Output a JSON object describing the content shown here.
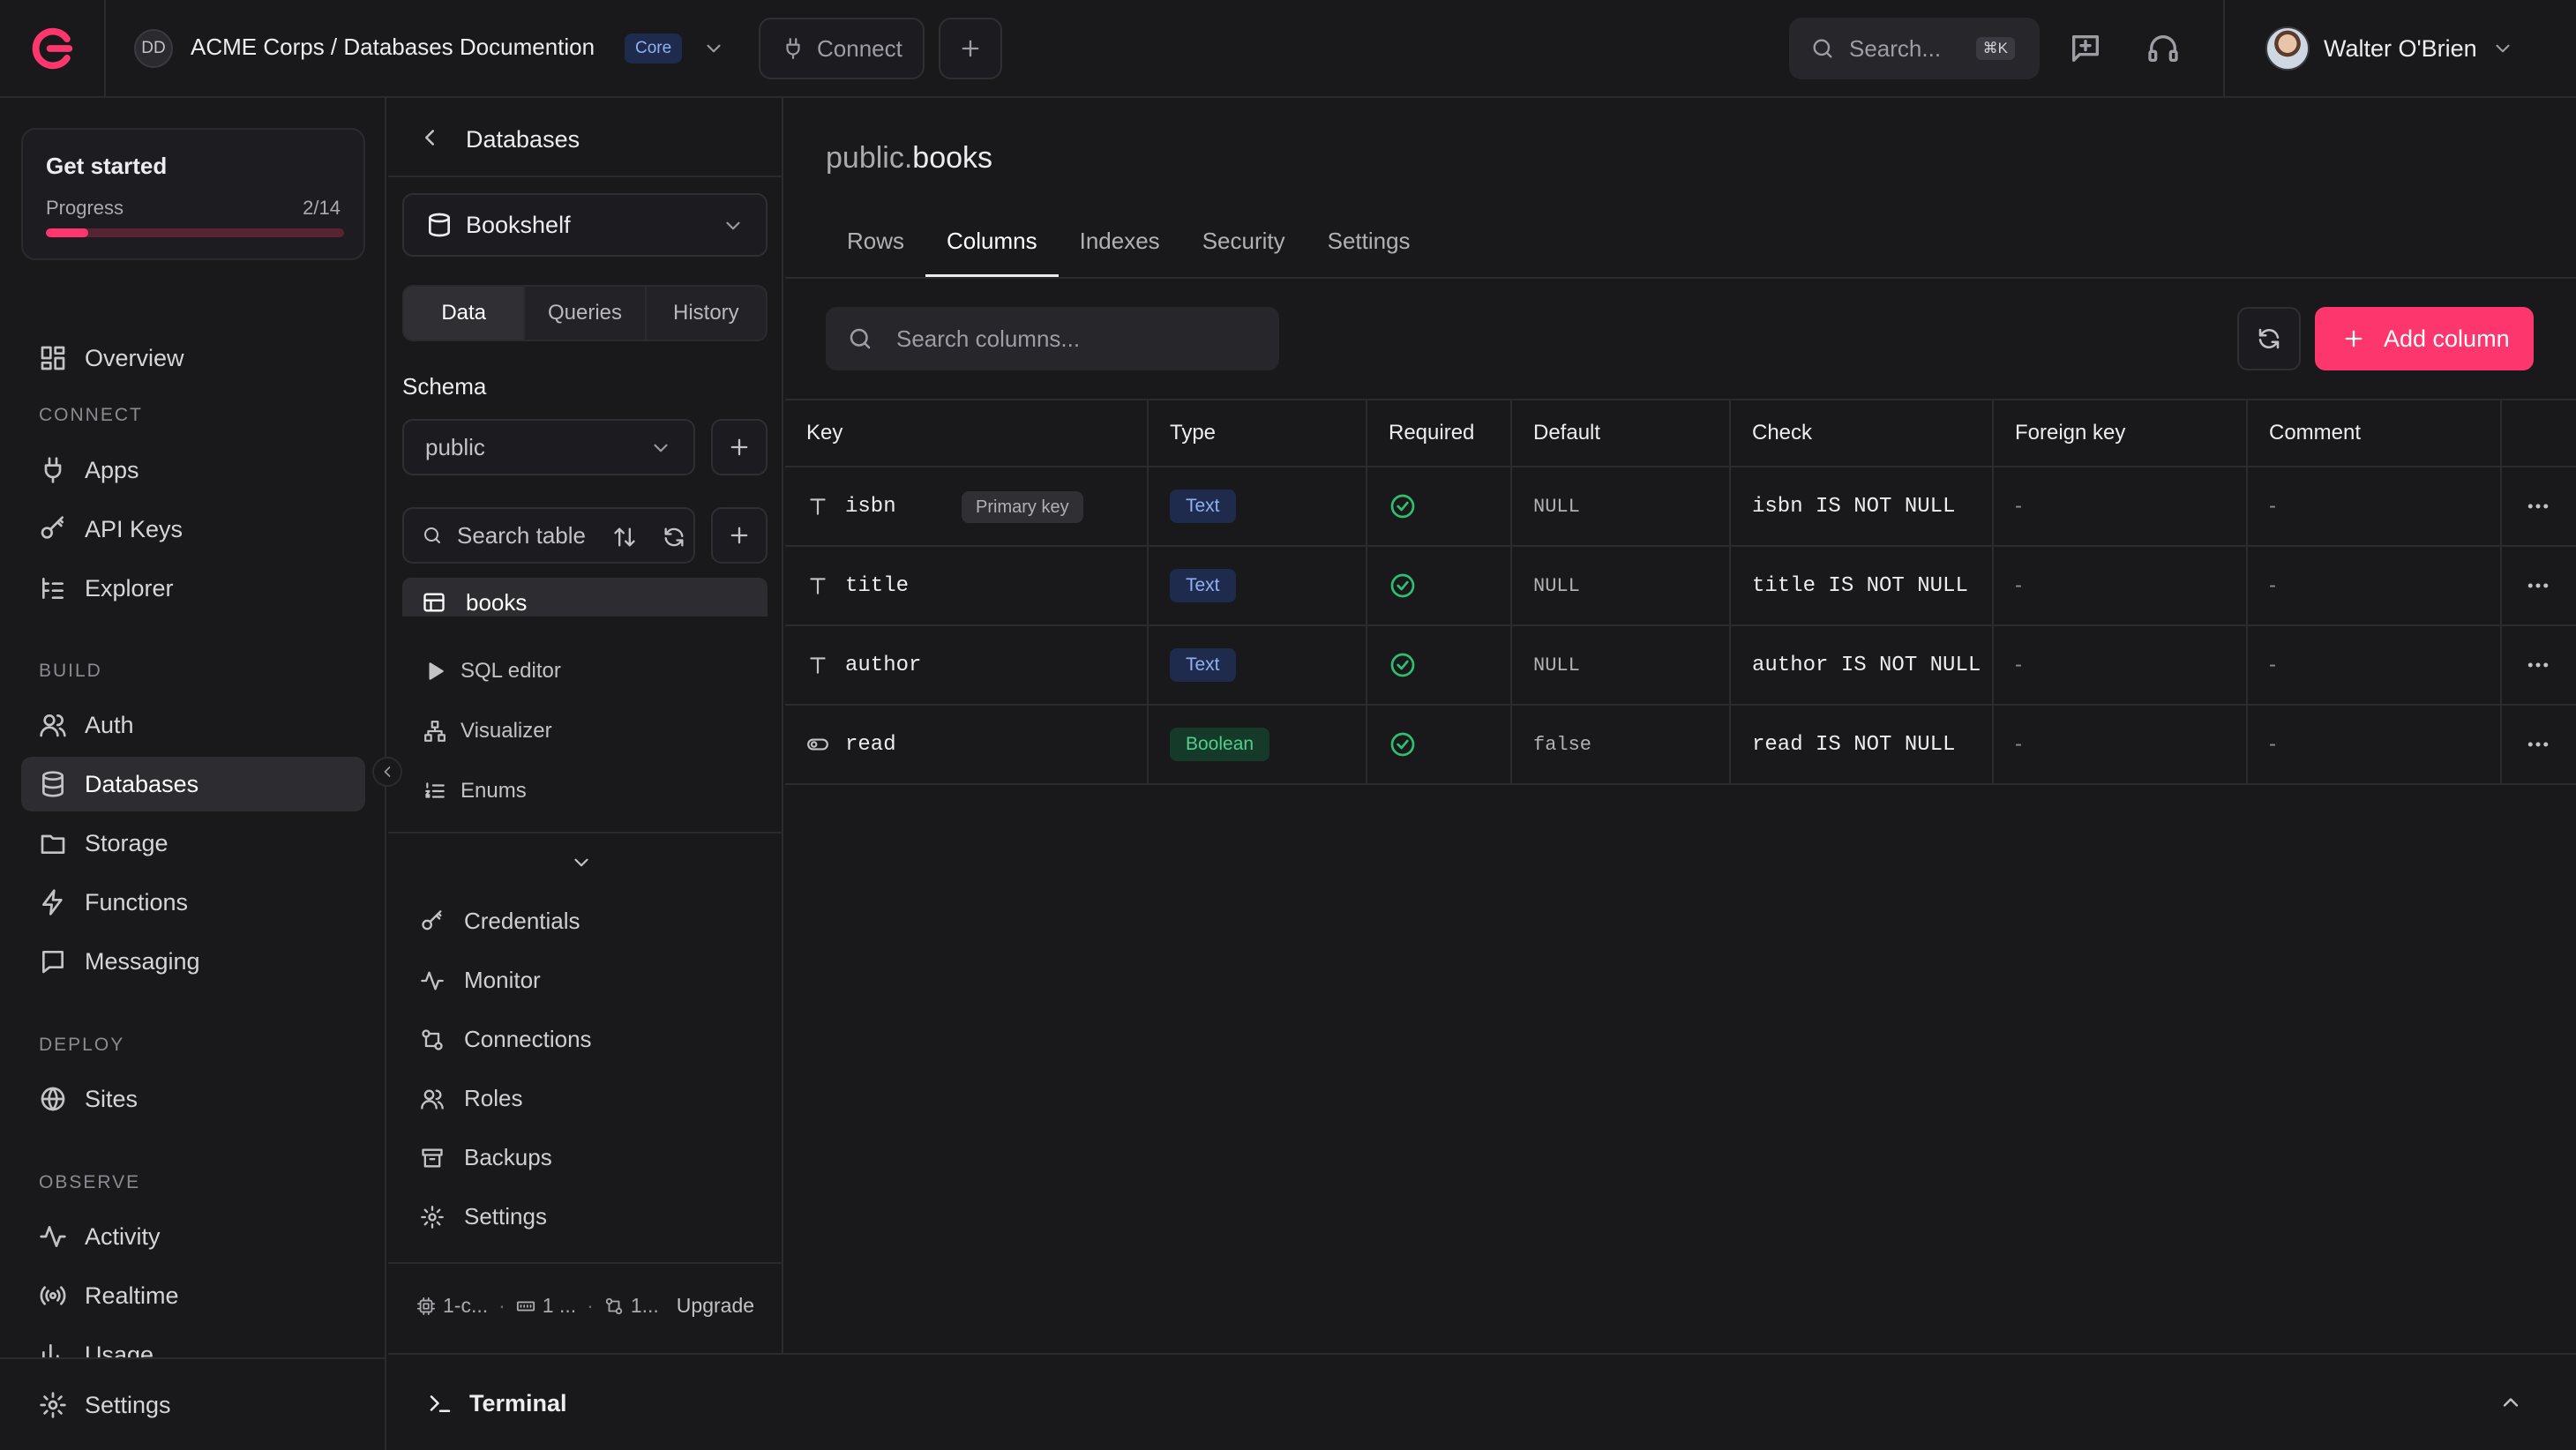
{
  "topbar": {
    "org_initials": "DD",
    "org_title": "ACME Corps / Databases Documention",
    "org_badge": "Core",
    "connect_label": "Connect",
    "search_placeholder": "Search...",
    "search_shortcut": "⌘K",
    "user_name": "Walter O'Brien"
  },
  "sidebar": {
    "get_started": {
      "title": "Get started",
      "progress_label": "Progress",
      "progress_count": "2/14",
      "progress_fraction": 0.143
    },
    "overview": "Overview",
    "sections": {
      "connect": "CONNECT",
      "build": "BUILD",
      "deploy": "DEPLOY",
      "observe": "OBSERVE"
    },
    "connect_items": [
      "Apps",
      "API Keys",
      "Explorer"
    ],
    "build_items": [
      "Auth",
      "Databases",
      "Storage",
      "Functions",
      "Messaging"
    ],
    "deploy_items": [
      "Sites"
    ],
    "observe_items": [
      "Activity",
      "Realtime",
      "Usage"
    ],
    "settings": "Settings",
    "active_item": "Databases"
  },
  "panel": {
    "title": "Databases",
    "database": "Bookshelf",
    "seg_tabs": [
      "Data",
      "Queries",
      "History"
    ],
    "active_seg": "Data",
    "schema_label": "Schema",
    "schema_value": "public",
    "table_search_placeholder": "Search table",
    "tables": [
      "books"
    ],
    "tools": [
      "SQL editor",
      "Visualizer",
      "Enums"
    ],
    "items": [
      "Credentials",
      "Monitor",
      "Connections",
      "Roles",
      "Backups",
      "Settings"
    ],
    "footer": {
      "cpu": "1-c...",
      "memory": "1 ...",
      "connections": "1...",
      "upgrade": "Upgrade"
    }
  },
  "main": {
    "title_schema": "public.",
    "title_table": "books",
    "tabs": [
      "Rows",
      "Columns",
      "Indexes",
      "Security",
      "Settings"
    ],
    "active_tab": "Columns",
    "search_placeholder": "Search columns...",
    "add_button": "Add column",
    "columns": [
      "Key",
      "Type",
      "Required",
      "Default",
      "Check",
      "Foreign key",
      "Comment"
    ],
    "rows": [
      {
        "key": "isbn",
        "key_icon": "text-type-icon",
        "badge": "Primary key",
        "type": "Text",
        "required": true,
        "default": "NULL",
        "check": "isbn IS NOT NULL",
        "foreign_key": "-",
        "comment": "-"
      },
      {
        "key": "title",
        "key_icon": "text-type-icon",
        "badge": "",
        "type": "Text",
        "required": true,
        "default": "NULL",
        "check": "title IS NOT NULL",
        "foreign_key": "-",
        "comment": "-"
      },
      {
        "key": "author",
        "key_icon": "text-type-icon",
        "badge": "",
        "type": "Text",
        "required": true,
        "default": "NULL",
        "check": "author IS NOT NULL",
        "foreign_key": "-",
        "comment": "-"
      },
      {
        "key": "read",
        "key_icon": "toggle-type-icon",
        "badge": "",
        "type": "Boolean",
        "required": true,
        "default": "false",
        "check": "read IS NOT NULL",
        "foreign_key": "-",
        "comment": "-"
      }
    ]
  },
  "terminal": {
    "label": "Terminal"
  },
  "colors": {
    "accent": "#fd366e",
    "background": "#19191c",
    "border": "#2a2a2f",
    "success": "#2fbf71",
    "text_badge": "#8fb1f4",
    "bool_badge": "#4fd08a"
  }
}
